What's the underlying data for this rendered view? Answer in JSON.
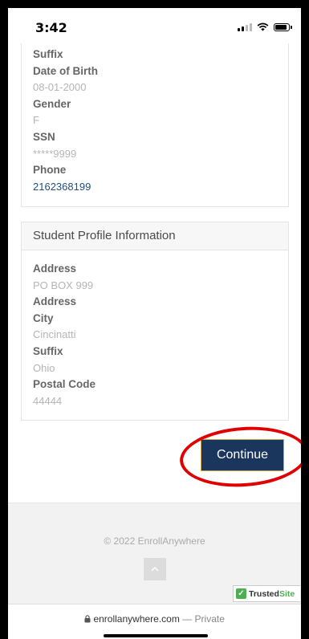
{
  "status_bar": {
    "time": "3:42"
  },
  "personal_card": {
    "fields": [
      {
        "label": "Suffix",
        "value": ""
      },
      {
        "label": "Date of Birth",
        "value": "08-01-2000"
      },
      {
        "label": "Gender",
        "value": "F"
      },
      {
        "label": "SSN",
        "value": "*****9999"
      },
      {
        "label": "Phone",
        "value": "2162368199"
      }
    ]
  },
  "profile_card": {
    "title": "Student Profile Information",
    "fields": [
      {
        "label": "Address",
        "value": "PO BOX 999"
      },
      {
        "label": "Address",
        "value": ""
      },
      {
        "label": "City",
        "value": "Cincinatti"
      },
      {
        "label": "Suffix",
        "value": "Ohio"
      },
      {
        "label": "Postal Code",
        "value": "44444"
      }
    ]
  },
  "continue_label": "Continue",
  "footer": {
    "copyright": "© 2022 EnrollAnywhere",
    "trusted_a": "Trusted",
    "trusted_b": "Site"
  },
  "url_bar": {
    "domain": "enrollanywhere.com",
    "private": "— Private"
  }
}
